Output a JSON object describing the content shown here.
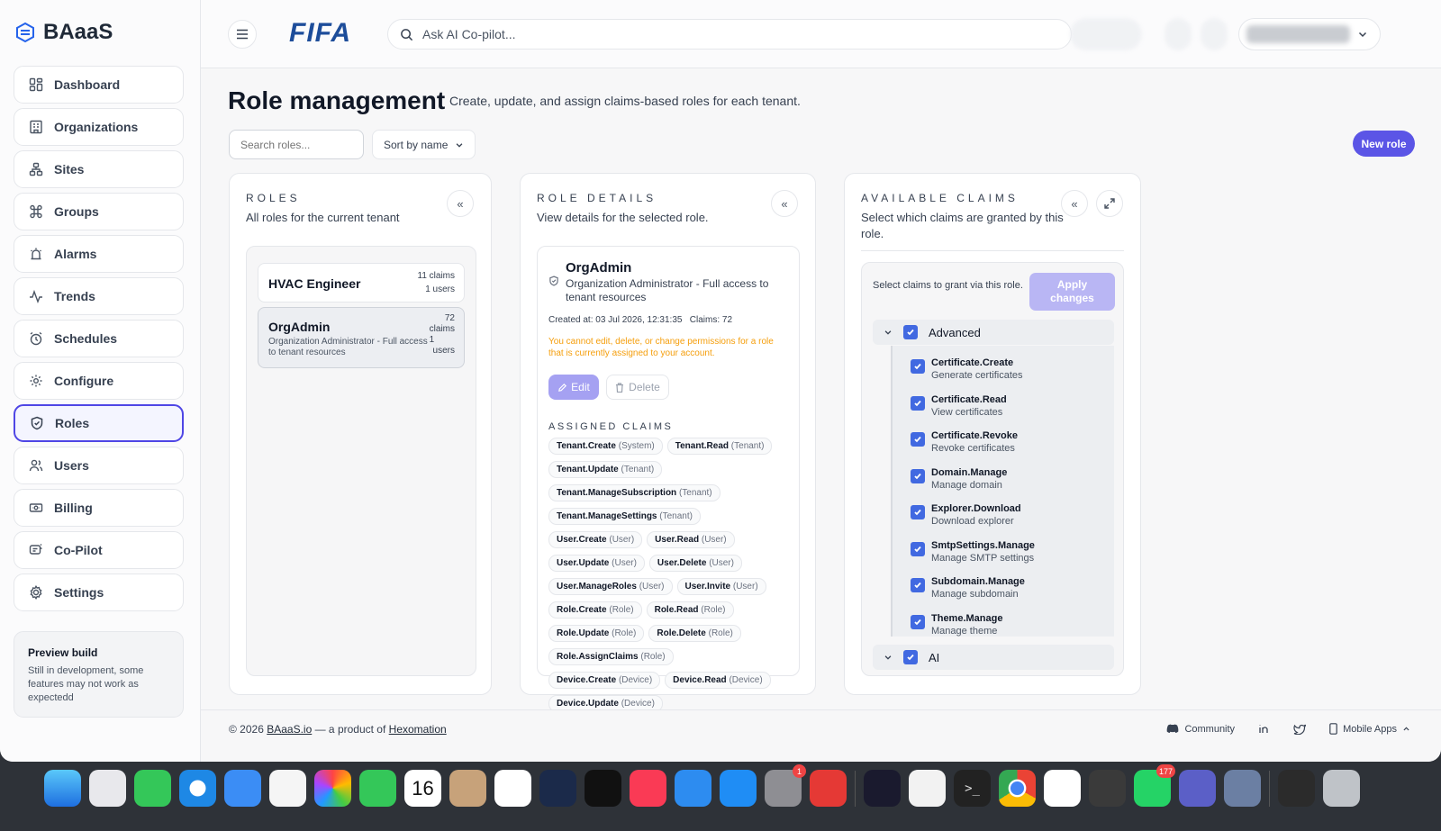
{
  "brand": {
    "name": "BAaaS"
  },
  "sidebar": {
    "items": [
      {
        "label": "Dashboard",
        "icon": "dashboard-icon"
      },
      {
        "label": "Organizations",
        "icon": "building-icon"
      },
      {
        "label": "Sites",
        "icon": "sites-icon"
      },
      {
        "label": "Groups",
        "icon": "command-icon"
      },
      {
        "label": "Alarms",
        "icon": "alarm-icon"
      },
      {
        "label": "Trends",
        "icon": "trend-icon"
      },
      {
        "label": "Schedules",
        "icon": "clock-icon"
      },
      {
        "label": "Configure",
        "icon": "gear-icon"
      },
      {
        "label": "Roles",
        "icon": "shield-icon",
        "active": true
      },
      {
        "label": "Users",
        "icon": "users-icon"
      },
      {
        "label": "Billing",
        "icon": "billing-icon"
      },
      {
        "label": "Co-Pilot",
        "icon": "copilot-icon"
      },
      {
        "label": "Settings",
        "icon": "settings-icon"
      }
    ],
    "preview": {
      "title": "Preview build",
      "text": "Still in development, some features may not work as expectedd"
    }
  },
  "topbar": {
    "logo": "FIFA",
    "search_placeholder": "Ask AI Co-pilot..."
  },
  "page": {
    "title": "Role management",
    "subtitle": "Create, update, and assign claims-based roles for each tenant.",
    "search_placeholder": "Search roles...",
    "sort_label": "Sort by name",
    "new_role": "New role"
  },
  "roles_panel": {
    "title": "ROLES",
    "subtitle": "All roles for the current tenant",
    "roles": [
      {
        "name": "HVAC Engineer",
        "claims": "11 claims",
        "users": "1 users"
      },
      {
        "name": "OrgAdmin",
        "desc": "Organization Administrator - Full access to tenant resources",
        "claims_num": "72",
        "claims_word": "claims",
        "users_num": "1",
        "users_word": "users"
      }
    ]
  },
  "details_panel": {
    "title": "ROLE DETAILS",
    "subtitle": "View details for the selected role.",
    "role_name": "OrgAdmin",
    "role_desc": "Organization Administrator - Full access to tenant resources",
    "created": "Created at: 03 Jul 2026, 12:31:35   Claims: 72",
    "warning": "You cannot edit, delete, or change permissions for a role that is currently assigned to your account.",
    "edit": "Edit",
    "delete": "Delete",
    "assigned_title": "ASSIGNED CLAIMS",
    "claims": [
      {
        "n": "Tenant.Create",
        "s": "(System)"
      },
      {
        "n": "Tenant.Read",
        "s": "(Tenant)"
      },
      {
        "n": "Tenant.Update",
        "s": "(Tenant)"
      },
      {
        "n": "Tenant.ManageSubscription",
        "s": "(Tenant)"
      },
      {
        "n": "Tenant.ManageSettings",
        "s": "(Tenant)"
      },
      {
        "n": "User.Create",
        "s": "(User)"
      },
      {
        "n": "User.Read",
        "s": "(User)"
      },
      {
        "n": "User.Update",
        "s": "(User)"
      },
      {
        "n": "User.Delete",
        "s": "(User)"
      },
      {
        "n": "User.ManageRoles",
        "s": "(User)"
      },
      {
        "n": "User.Invite",
        "s": "(User)"
      },
      {
        "n": "Role.Create",
        "s": "(Role)"
      },
      {
        "n": "Role.Read",
        "s": "(Role)"
      },
      {
        "n": "Role.Update",
        "s": "(Role)"
      },
      {
        "n": "Role.Delete",
        "s": "(Role)"
      },
      {
        "n": "Role.AssignClaims",
        "s": "(Role)"
      },
      {
        "n": "Device.Create",
        "s": "(Device)"
      },
      {
        "n": "Device.Read",
        "s": "(Device)"
      },
      {
        "n": "Device.Update",
        "s": "(Device)"
      }
    ]
  },
  "claims_panel": {
    "title": "AVAILABLE CLAIMS",
    "subtitle": "Select which claims are granted by this role.",
    "hint": "Select claims to grant via this role.",
    "apply": "Apply changes",
    "group_advanced": "Advanced",
    "group_ai": "AI",
    "items": [
      {
        "name": "Certificate.Create",
        "desc": "Generate certificates"
      },
      {
        "name": "Certificate.Read",
        "desc": "View certificates"
      },
      {
        "name": "Certificate.Revoke",
        "desc": "Revoke certificates"
      },
      {
        "name": "Domain.Manage",
        "desc": "Manage domain"
      },
      {
        "name": "Explorer.Download",
        "desc": "Download explorer"
      },
      {
        "name": "SmtpSettings.Manage",
        "desc": "Manage SMTP settings"
      },
      {
        "name": "Subdomain.Manage",
        "desc": "Manage subdomain"
      },
      {
        "name": "Theme.Manage",
        "desc": "Manage theme"
      }
    ]
  },
  "footer": {
    "copyright": "© 2026 ",
    "site": "BAaaS.io",
    "mid": " — a product of ",
    "company": "Hexomation",
    "community": "Community",
    "mobile": "Mobile Apps"
  },
  "dock": {
    "calendar_day": "16",
    "settings_badge": "1",
    "whatsapp_badge": "177"
  },
  "colors": {
    "accent": "#5b55e6",
    "checkbox": "#4169e1",
    "warning": "#f59e0b"
  }
}
